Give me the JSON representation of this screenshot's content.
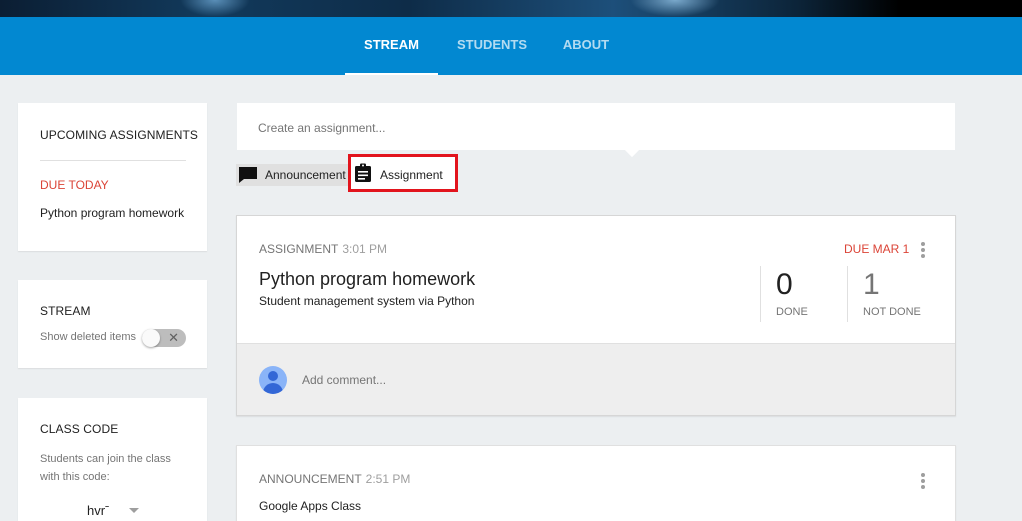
{
  "nav": {
    "tabs": [
      {
        "label": "STREAM",
        "active": true
      },
      {
        "label": "STUDENTS",
        "active": false
      },
      {
        "label": "ABOUT",
        "active": false
      }
    ]
  },
  "sidebar": {
    "upcoming": {
      "title": "UPCOMING ASSIGNMENTS",
      "due_label": "DUE TODAY",
      "item": "Python program homework"
    },
    "stream": {
      "title": "STREAM",
      "toggle_label": "Show deleted items",
      "toggle_on": false
    },
    "class_code": {
      "title": "CLASS CODE",
      "description": "Students can join the class with this code:",
      "code": "hvrˉ"
    }
  },
  "composer": {
    "placeholder": "Create an assignment...",
    "announcement_label": "Announcement",
    "assignment_label": "Assignment"
  },
  "posts": [
    {
      "type_label": "ASSIGNMENT",
      "time": "3:01 PM",
      "due": "DUE MAR 1",
      "title": "Python program homework",
      "description": "Student management system via Python",
      "done_count": "0",
      "done_label": "DONE",
      "not_done_count": "1",
      "not_done_label": "NOT DONE",
      "comment_placeholder": "Add comment..."
    },
    {
      "type_label": "ANNOUNCEMENT",
      "time": "2:51 PM",
      "text": "Google Apps Class"
    }
  ],
  "colors": {
    "nav_bg": "#0288d1",
    "due_red": "#db4437",
    "highlight_border": "#e2141d",
    "page_bg": "#eceff1"
  },
  "icons": {
    "announcement": "chat-bubble-icon",
    "assignment": "clipboard-icon",
    "more": "more-vert-icon",
    "toggle_off": "close-icon",
    "dropdown": "caret-down-icon",
    "avatar": "person-icon"
  }
}
